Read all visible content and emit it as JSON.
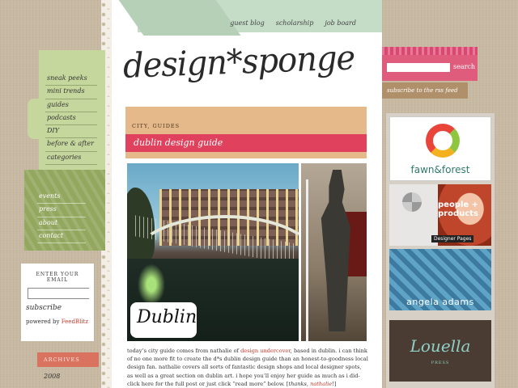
{
  "topnav": {
    "links": [
      "guest blog",
      "scholarship",
      "job board"
    ]
  },
  "logo": {
    "text": "design*sponge"
  },
  "sidebar": {
    "nav1": [
      "sneak peeks",
      "mini trends",
      "guides",
      "podcasts",
      "DIY",
      "before & after",
      "categories"
    ],
    "nav2": [
      "events",
      "press",
      "about",
      "contact"
    ]
  },
  "email": {
    "label": "ENTER YOUR EMAIL",
    "subscribe": "subscribe",
    "powered": "powered by ",
    "feedblitz": "FeedBlitz"
  },
  "archives": {
    "label": "ARCHIVES",
    "year": "2008"
  },
  "search": {
    "button": "search"
  },
  "rss": {
    "label": "subscribe to the rss feed"
  },
  "ads": {
    "ad1": "fawn&forest",
    "ad2": "people + products",
    "ad2_sub": "Designer Pages",
    "ad3": "angela adams",
    "ad4": "Louella",
    "ad4_sub": "PRESS"
  },
  "post": {
    "category": "CITY, GUIDES",
    "title": "dublin design guide",
    "badge": "Dublin",
    "body1": "today’s city guide comes from nathalie of ",
    "link1": "design undercover",
    "body2": ", based in dublin. i can think of no one more fit to create the d*s dublin design guide than an honest-to-goodness local design fan. nathalie covers all sorts of fantastic design shops and local designer spots, as well as a great section on dublin art. i hope you’ll enjoy her guide as much as i did- click here for the full post or just click “read more” below. [",
    "thanks": "thanks, ",
    "link2": "nathalie",
    "end": "!]"
  },
  "colors": {
    "accent": "#e0415c",
    "green": "#93a75f",
    "tan": "#e5b98a"
  }
}
